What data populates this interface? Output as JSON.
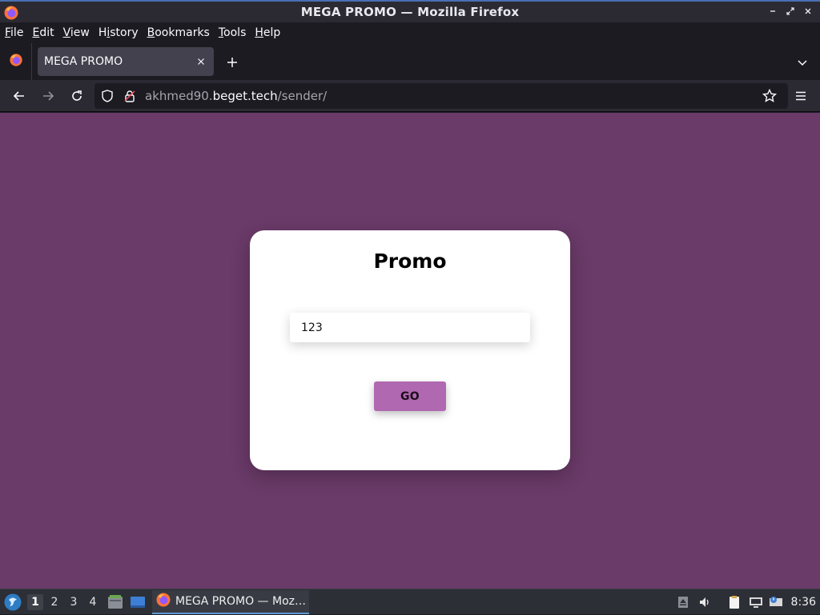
{
  "window": {
    "title": "MEGA PROMO — Mozilla Firefox"
  },
  "menubar": {
    "items": [
      {
        "first": "F",
        "rest": "ile"
      },
      {
        "first": "E",
        "rest": "dit"
      },
      {
        "first": "V",
        "rest": "iew"
      },
      {
        "first": "",
        "mid": "H",
        "rest": "istory"
      },
      {
        "first": "B",
        "rest": "ookmarks"
      },
      {
        "first": "T",
        "rest": "ools"
      },
      {
        "first": "H",
        "rest": "elp"
      }
    ]
  },
  "tab": {
    "label": "MEGA PROMO"
  },
  "urlbar": {
    "prefix": "akhmed90.",
    "host": "beget.tech",
    "path": "/sender/"
  },
  "page": {
    "title": "Promo",
    "input_value": "123",
    "button_label": "GO",
    "background_color": "#6a3a68",
    "button_color": "#b068b0"
  },
  "taskbar": {
    "workspaces": [
      "1",
      "2",
      "3",
      "4"
    ],
    "active_workspace": "1",
    "task_label": "MEGA PROMO — Moz…",
    "clock": "8:36"
  }
}
